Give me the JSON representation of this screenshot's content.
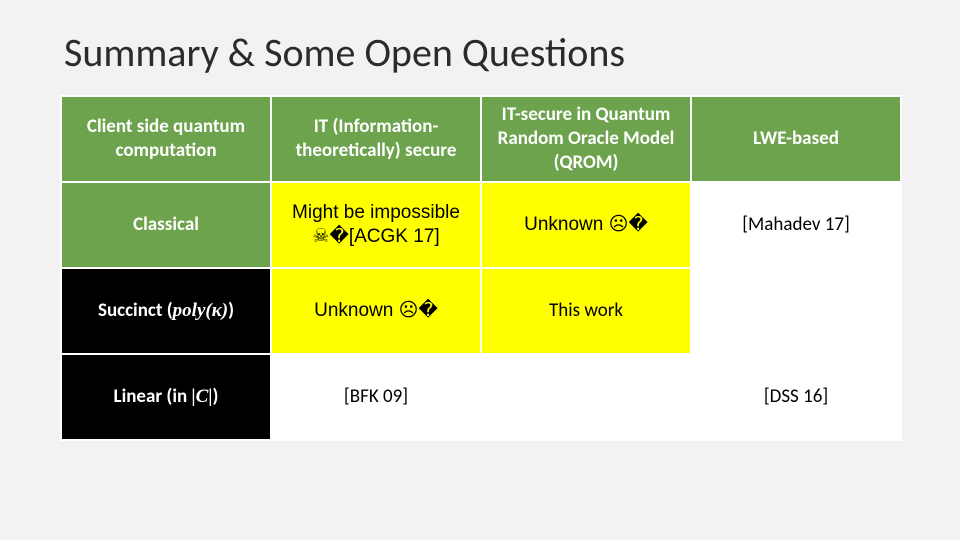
{
  "title": "Summary & Some Open Questions",
  "table": {
    "header": {
      "row_label": "Client side quantum computation",
      "col_it": "IT (Information-theoretically) secure",
      "col_qrom": "IT-secure in Quantum Random Oracle Model (QROM)",
      "col_lwe": "LWE-based"
    },
    "rows": {
      "classical": {
        "label": "Classical",
        "it": "Might be impossible ☠�[ACGK 17]",
        "qrom": "Unknown ☹�",
        "lwe": "[Mahadev 17]"
      },
      "succinct": {
        "label_prefix": "Succinct (",
        "label_math": "poly(κ)",
        "label_suffix": ")",
        "it": "Unknown ☹�",
        "qrom": "This work",
        "lwe": ""
      },
      "linear": {
        "label_prefix": "Linear (in ",
        "label_math": "|C|",
        "label_suffix": ")",
        "it": "[BFK 09]",
        "qrom": "",
        "lwe": "[DSS 16]"
      }
    }
  }
}
